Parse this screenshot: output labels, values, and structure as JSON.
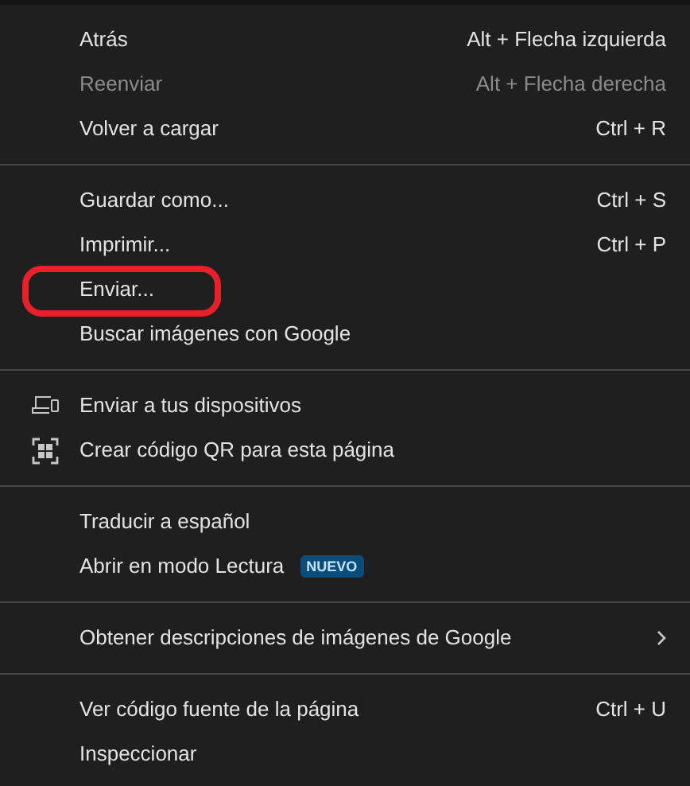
{
  "menu": {
    "groups": [
      {
        "items": [
          {
            "label": "Atrás",
            "shortcut": "Alt + Flecha izquierda",
            "disabled": false
          },
          {
            "label": "Reenviar",
            "shortcut": "Alt + Flecha derecha",
            "disabled": true
          },
          {
            "label": "Volver a cargar",
            "shortcut": "Ctrl + R",
            "disabled": false
          }
        ]
      },
      {
        "items": [
          {
            "label": "Guardar como...",
            "shortcut": "Ctrl + S",
            "disabled": false
          },
          {
            "label": "Imprimir...",
            "shortcut": "Ctrl + P",
            "disabled": false
          },
          {
            "label": "Enviar...",
            "disabled": false,
            "annotated": true
          },
          {
            "label": "Buscar imágenes con Google",
            "disabled": false
          }
        ]
      },
      {
        "items": [
          {
            "label": "Enviar a tus dispositivos",
            "disabled": false,
            "kind": "devices"
          },
          {
            "label": "Crear código QR para esta página",
            "disabled": false,
            "kind": "qr"
          }
        ]
      },
      {
        "items": [
          {
            "label": "Traducir a español",
            "disabled": false
          },
          {
            "label": "Abrir en modo Lectura",
            "disabled": false,
            "badge": "NUEVO"
          }
        ]
      },
      {
        "items": [
          {
            "label": "Obtener descripciones de imágenes de Google",
            "disabled": false,
            "submenu": true
          }
        ]
      },
      {
        "items": [
          {
            "label": "Ver código fuente de la página",
            "shortcut": "Ctrl + U",
            "disabled": false
          },
          {
            "label": "Inspeccionar",
            "disabled": false
          }
        ]
      }
    ]
  }
}
